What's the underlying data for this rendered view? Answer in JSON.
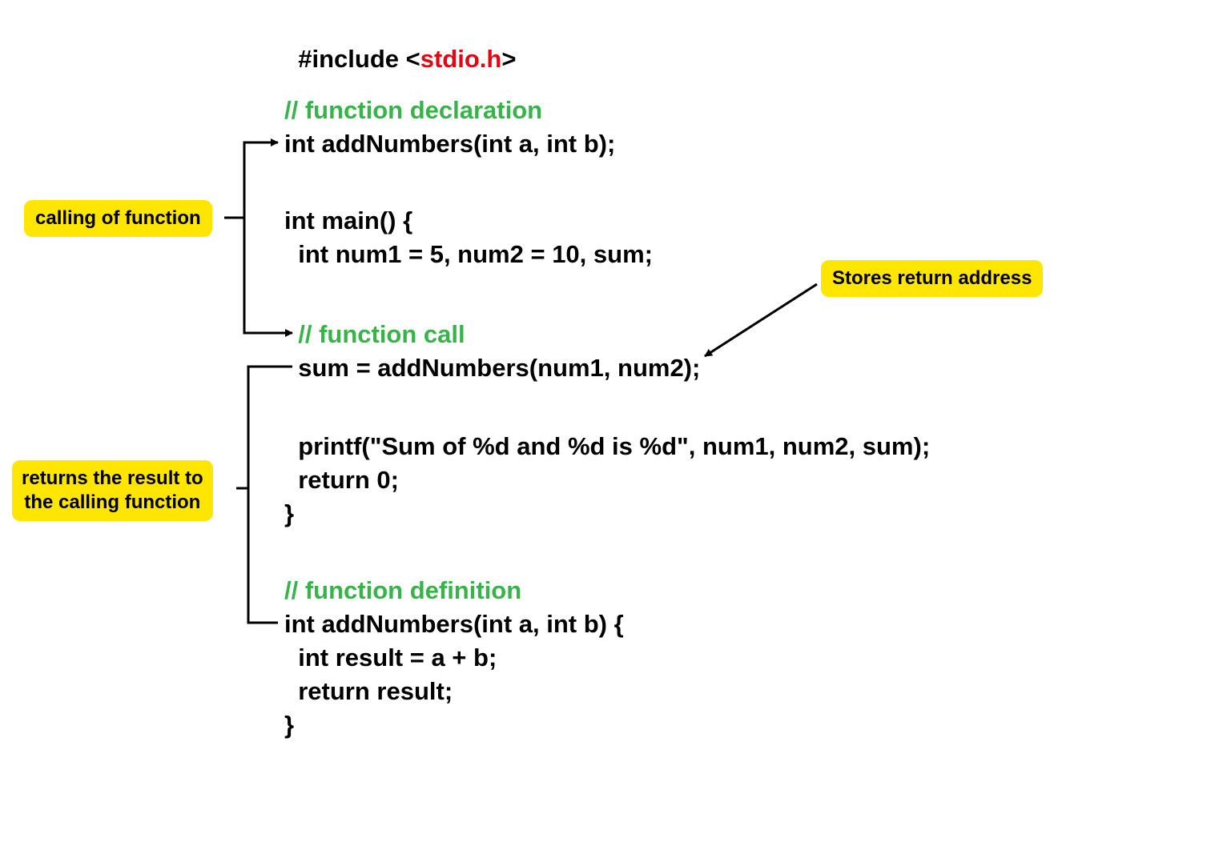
{
  "code": {
    "l1a": "#include <",
    "l1b": "stdio.h",
    "l1c": ">",
    "c1": "// function declaration",
    "l2": "int addNumbers(int a, int b);",
    "l3": "int main() {",
    "l4": "  int num1 = 5, num2 = 10, sum;",
    "c2": "  // function call",
    "l5": "  sum = addNumbers(num1, num2);",
    "l6": "  printf(\"Sum of %d and %d is %d\", num1, num2, sum);",
    "l7": "  return 0;",
    "l8": "}",
    "c3": "// function definition",
    "l9": "int addNumbers(int a, int b) {",
    "l10": "  int result = a + b;",
    "l11": "  return result;",
    "l12": "}"
  },
  "labels": {
    "calling": "calling of function",
    "returns1": "returns the result to",
    "returns2": "the calling function",
    "stores": "Stores return address"
  }
}
